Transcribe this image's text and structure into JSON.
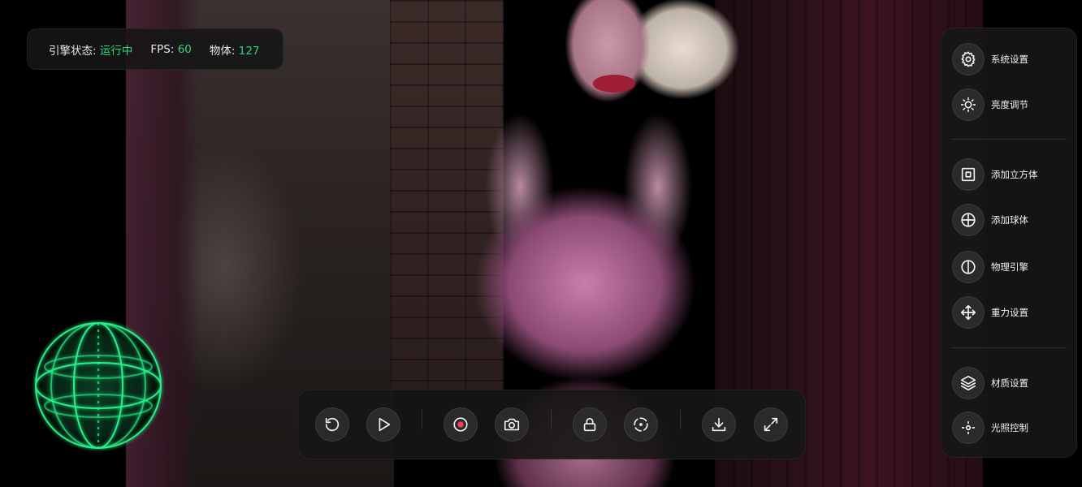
{
  "status": {
    "engine_label": "引擎状态:",
    "engine_value": "运行中",
    "fps_label": "FPS:",
    "fps_value": "60",
    "objects_label": "物体:",
    "objects_value": "127"
  },
  "sidebar": {
    "items": [
      {
        "label": "系统设置",
        "icon": "gear-icon"
      },
      {
        "label": "亮度调节",
        "icon": "sun-icon"
      },
      {
        "label": "添加立方体",
        "icon": "cube-icon"
      },
      {
        "label": "添加球体",
        "icon": "sphere-icon"
      },
      {
        "label": "物理引擎",
        "icon": "physics-icon"
      },
      {
        "label": "重力设置",
        "icon": "move-icon"
      },
      {
        "label": "材质设置",
        "icon": "layers-icon"
      },
      {
        "label": "光照控制",
        "icon": "light-icon"
      }
    ]
  },
  "toolbar": {
    "buttons": [
      "reset-icon",
      "play-icon",
      "record-icon",
      "camera-icon",
      "lock-icon",
      "rotate-icon",
      "download-icon",
      "fullscreen-icon"
    ]
  },
  "colors": {
    "accent_green": "#2fd67a",
    "panel_bg": "#161616",
    "gizmo_green": "#27f08a"
  }
}
